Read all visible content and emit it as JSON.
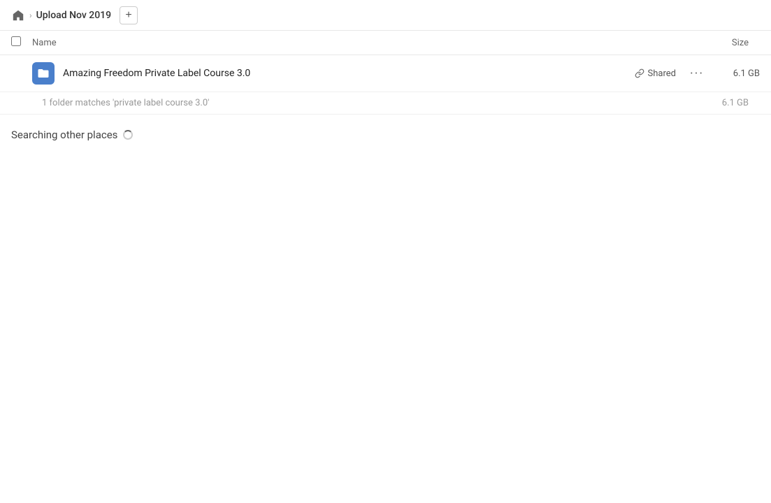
{
  "breadcrumb": {
    "home_icon": "home",
    "folder_name": "Upload Nov 2019",
    "add_button_label": "+"
  },
  "columns": {
    "name_label": "Name",
    "size_label": "Size"
  },
  "file_row": {
    "name": "Amazing Freedom Private Label Course 3.0",
    "shared_label": "Shared",
    "size": "6.1 GB",
    "more_icon": "···"
  },
  "match_info": {
    "text": "1 folder matches 'private label course 3.0'",
    "size": "6.1 GB"
  },
  "searching": {
    "label": "Searching other places"
  }
}
